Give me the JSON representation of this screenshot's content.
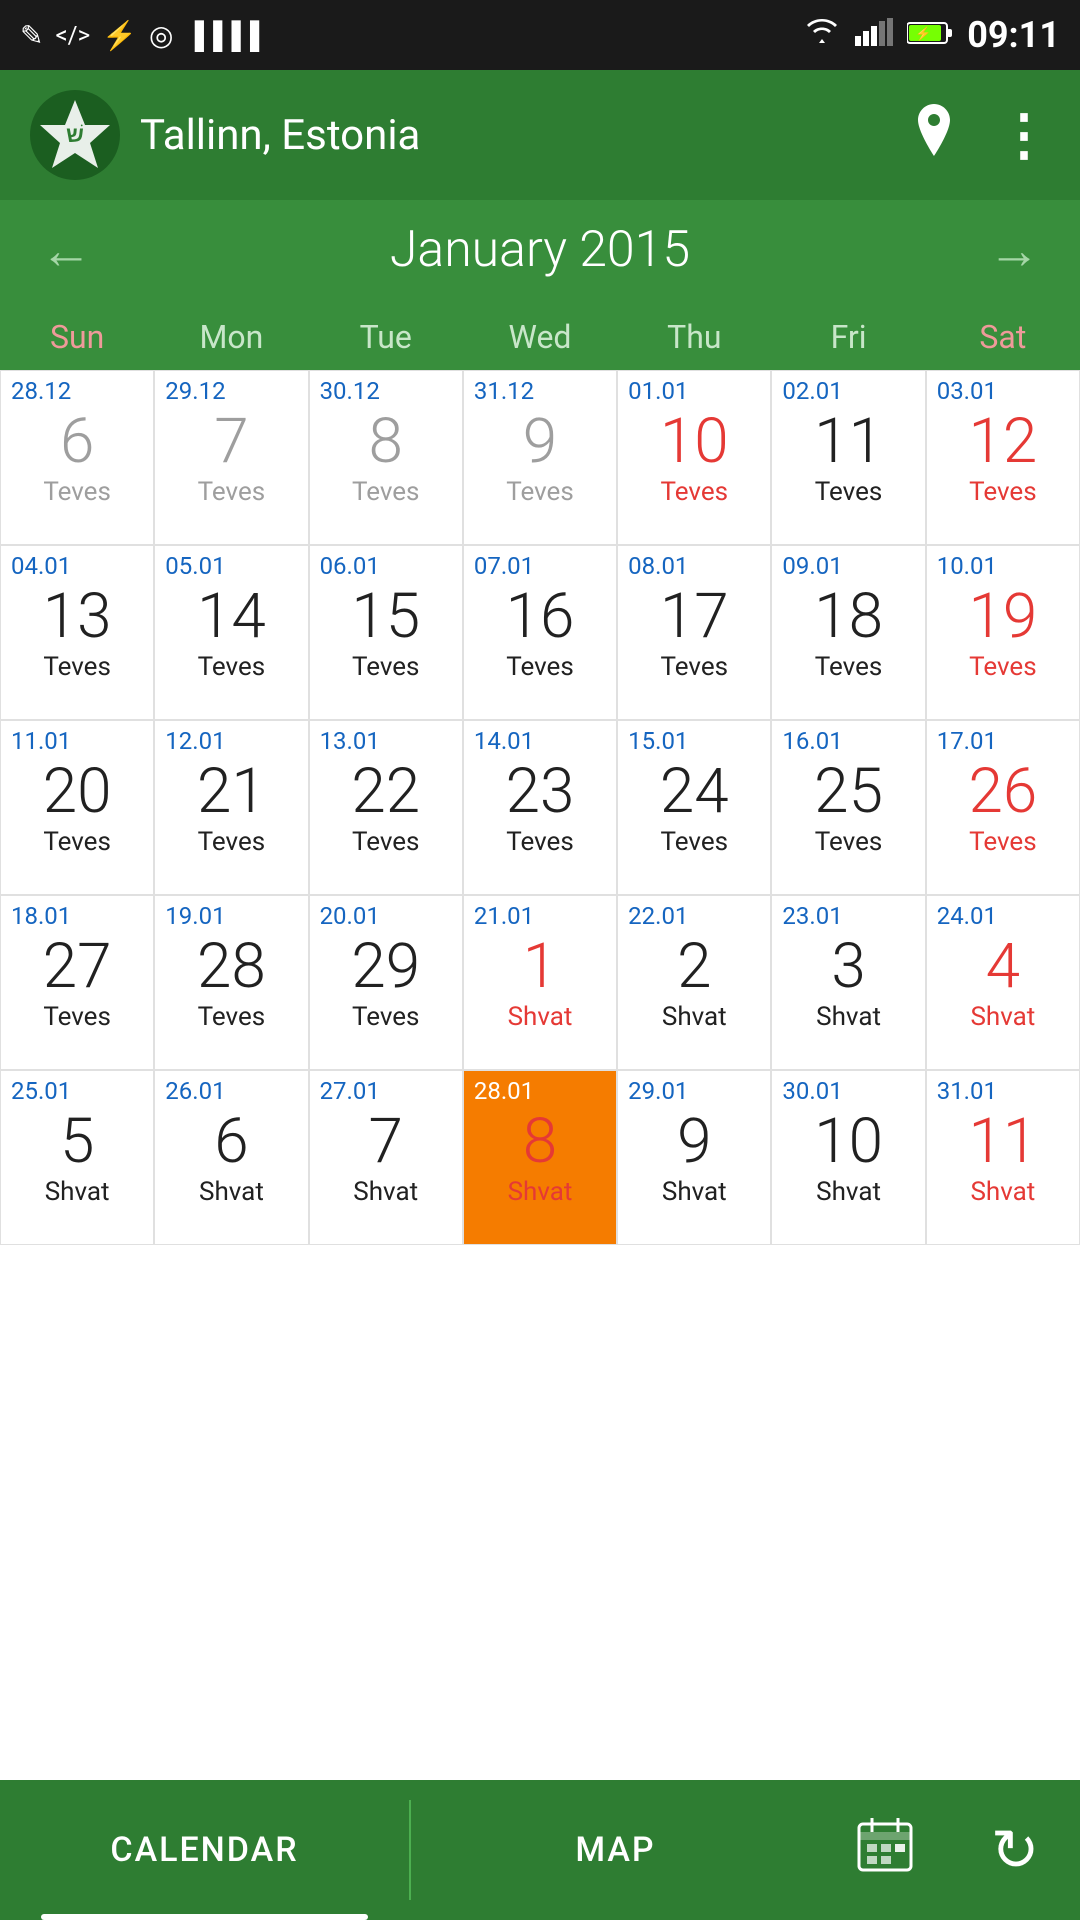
{
  "statusBar": {
    "time": "09:11",
    "iconsLeft": [
      "✎",
      "</>",
      "⚡",
      "◎",
      "▐▌▐"
    ],
    "iconsRight": [
      "wifi",
      "signal",
      "battery"
    ]
  },
  "header": {
    "appName": "Tallinn, Estonia",
    "locationIcon": "📍",
    "menuIcon": "⋮"
  },
  "calendar": {
    "monthYear": "January 2015",
    "prevArrow": "←",
    "nextArrow": "→",
    "weekdays": [
      "Sun",
      "Mon",
      "Tue",
      "Wed",
      "Thu",
      "Fri",
      "Sat"
    ],
    "rows": [
      [
        {
          "greg": "28.12",
          "num": "6",
          "heb": "Teves",
          "numColor": "gray",
          "hebColor": "gray",
          "gregColor": "blue"
        },
        {
          "greg": "29.12",
          "num": "7",
          "heb": "Teves",
          "numColor": "gray",
          "hebColor": "gray",
          "gregColor": "blue"
        },
        {
          "greg": "30.12",
          "num": "8",
          "heb": "Teves",
          "numColor": "gray",
          "hebColor": "gray",
          "gregColor": "blue"
        },
        {
          "greg": "31.12",
          "num": "9",
          "heb": "Teves",
          "numColor": "gray",
          "hebColor": "gray",
          "gregColor": "blue"
        },
        {
          "greg": "01.01",
          "num": "10",
          "heb": "Teves",
          "numColor": "red",
          "hebColor": "red",
          "gregColor": "blue"
        },
        {
          "greg": "02.01",
          "num": "11",
          "heb": "Teves",
          "numColor": "black",
          "hebColor": "black",
          "gregColor": "blue"
        },
        {
          "greg": "03.01",
          "num": "12",
          "heb": "Teves",
          "numColor": "red",
          "hebColor": "red",
          "gregColor": "blue"
        }
      ],
      [
        {
          "greg": "04.01",
          "num": "13",
          "heb": "Teves",
          "numColor": "black",
          "hebColor": "black",
          "gregColor": "blue"
        },
        {
          "greg": "05.01",
          "num": "14",
          "heb": "Teves",
          "numColor": "black",
          "hebColor": "black",
          "gregColor": "blue"
        },
        {
          "greg": "06.01",
          "num": "15",
          "heb": "Teves",
          "numColor": "black",
          "hebColor": "black",
          "gregColor": "blue"
        },
        {
          "greg": "07.01",
          "num": "16",
          "heb": "Teves",
          "numColor": "black",
          "hebColor": "black",
          "gregColor": "blue"
        },
        {
          "greg": "08.01",
          "num": "17",
          "heb": "Teves",
          "numColor": "black",
          "hebColor": "black",
          "gregColor": "blue"
        },
        {
          "greg": "09.01",
          "num": "18",
          "heb": "Teves",
          "numColor": "black",
          "hebColor": "black",
          "gregColor": "blue"
        },
        {
          "greg": "10.01",
          "num": "19",
          "heb": "Teves",
          "numColor": "red",
          "hebColor": "red",
          "gregColor": "blue"
        }
      ],
      [
        {
          "greg": "11.01",
          "num": "20",
          "heb": "Teves",
          "numColor": "black",
          "hebColor": "black",
          "gregColor": "blue"
        },
        {
          "greg": "12.01",
          "num": "21",
          "heb": "Teves",
          "numColor": "black",
          "hebColor": "black",
          "gregColor": "blue"
        },
        {
          "greg": "13.01",
          "num": "22",
          "heb": "Teves",
          "numColor": "black",
          "hebColor": "black",
          "gregColor": "blue"
        },
        {
          "greg": "14.01",
          "num": "23",
          "heb": "Teves",
          "numColor": "black",
          "hebColor": "black",
          "gregColor": "blue"
        },
        {
          "greg": "15.01",
          "num": "24",
          "heb": "Teves",
          "numColor": "black",
          "hebColor": "black",
          "gregColor": "blue"
        },
        {
          "greg": "16.01",
          "num": "25",
          "heb": "Teves",
          "numColor": "black",
          "hebColor": "black",
          "gregColor": "blue"
        },
        {
          "greg": "17.01",
          "num": "26",
          "heb": "Teves",
          "numColor": "red",
          "hebColor": "red",
          "gregColor": "blue"
        }
      ],
      [
        {
          "greg": "18.01",
          "num": "27",
          "heb": "Teves",
          "numColor": "black",
          "hebColor": "black",
          "gregColor": "blue"
        },
        {
          "greg": "19.01",
          "num": "28",
          "heb": "Teves",
          "numColor": "black",
          "hebColor": "black",
          "gregColor": "blue"
        },
        {
          "greg": "20.01",
          "num": "29",
          "heb": "Teves",
          "numColor": "black",
          "hebColor": "black",
          "gregColor": "blue"
        },
        {
          "greg": "21.01",
          "num": "1",
          "heb": "Shvat",
          "numColor": "red",
          "hebColor": "red",
          "gregColor": "blue"
        },
        {
          "greg": "22.01",
          "num": "2",
          "heb": "Shvat",
          "numColor": "black",
          "hebColor": "black",
          "gregColor": "blue"
        },
        {
          "greg": "23.01",
          "num": "3",
          "heb": "Shvat",
          "numColor": "black",
          "hebColor": "black",
          "gregColor": "blue"
        },
        {
          "greg": "24.01",
          "num": "4",
          "heb": "Shvat",
          "numColor": "red",
          "hebColor": "red",
          "gregColor": "blue"
        }
      ],
      [
        {
          "greg": "25.01",
          "num": "5",
          "heb": "Shvat",
          "numColor": "black",
          "hebColor": "black",
          "gregColor": "blue"
        },
        {
          "greg": "26.01",
          "num": "6",
          "heb": "Shvat",
          "numColor": "black",
          "hebColor": "black",
          "gregColor": "blue"
        },
        {
          "greg": "27.01",
          "num": "7",
          "heb": "Shvat",
          "numColor": "black",
          "hebColor": "black",
          "gregColor": "blue"
        },
        {
          "greg": "28.01",
          "num": "8",
          "heb": "Shvat",
          "numColor": "red",
          "hebColor": "red",
          "gregColor": "blue",
          "today": true
        },
        {
          "greg": "29.01",
          "num": "9",
          "heb": "Shvat",
          "numColor": "black",
          "hebColor": "black",
          "gregColor": "blue"
        },
        {
          "greg": "30.01",
          "num": "10",
          "heb": "Shvat",
          "numColor": "black",
          "hebColor": "black",
          "gregColor": "blue"
        },
        {
          "greg": "31.01",
          "num": "11",
          "heb": "Shvat",
          "numColor": "red",
          "hebColor": "red",
          "gregColor": "blue"
        }
      ]
    ]
  },
  "bottomNav": {
    "calendarLabel": "CALENDAR",
    "mapLabel": "MAP",
    "calendarIcon": "🗓",
    "refreshIcon": "↻"
  }
}
